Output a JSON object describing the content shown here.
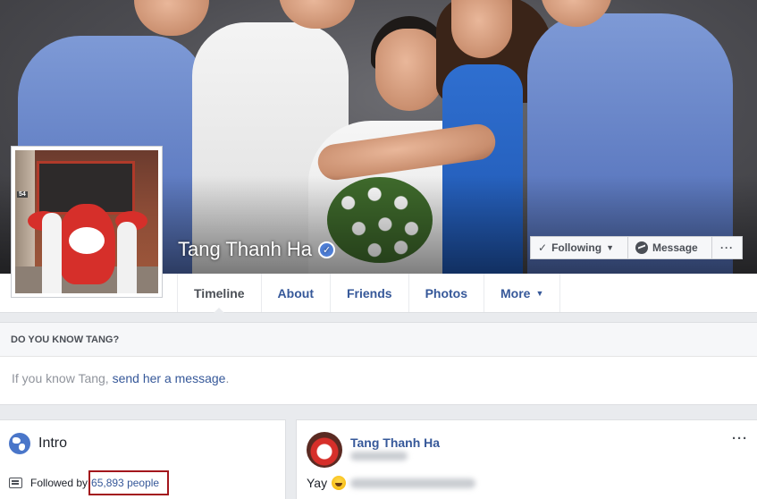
{
  "profile": {
    "name": "Tang Thanh Ha",
    "verified": true,
    "verified_mark": "✓"
  },
  "actions": {
    "following_label": "Following",
    "message_label": "Message",
    "more_label": "···",
    "caret": "▼"
  },
  "tabs": [
    {
      "label": "Timeline",
      "active": true
    },
    {
      "label": "About"
    },
    {
      "label": "Friends"
    },
    {
      "label": "Photos"
    },
    {
      "label": "More"
    }
  ],
  "know_card": {
    "heading": "DO YOU KNOW TANG?",
    "text_prefix": "If you know Tang, ",
    "link_text": "send her a message",
    "text_suffix": "."
  },
  "intro": {
    "title": "Intro",
    "followed_prefix": "Followed by ",
    "followers_link": "65,893 people"
  },
  "post": {
    "author": "Tang Thanh Ha",
    "text": "Yay",
    "menu_dots": "···"
  },
  "avatar_sign": "54",
  "colors": {
    "link": "#365899",
    "verified": "#4e7ed6",
    "highlight_box": "#a3161c",
    "page_bg": "#e9ebee"
  },
  "icons": [
    "check-icon",
    "caret-down-icon",
    "messenger-icon",
    "more-dots-icon",
    "verified-badge-icon",
    "globe-icon",
    "rss-icon",
    "emoji-laugh-icon"
  ]
}
